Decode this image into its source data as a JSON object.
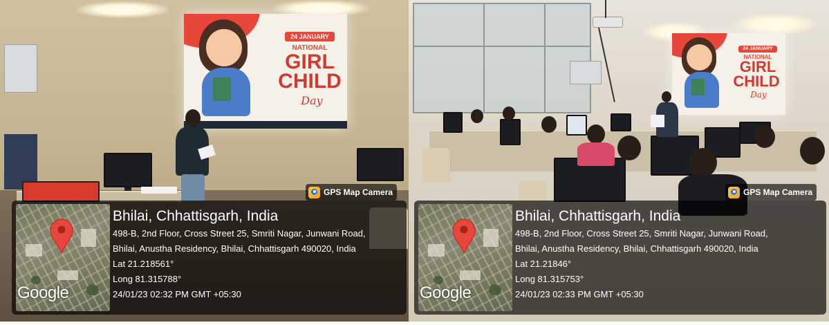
{
  "photos": [
    {
      "projected_slide": {
        "date": "24 JANUARY",
        "line1": "NATIONAL",
        "line2": "GIRL",
        "line3": "CHILD",
        "line4": "Day"
      },
      "badge": {
        "icon": "gps-map-camera-icon",
        "label": "GPS Map Camera"
      },
      "location": {
        "title": "Bhilai, Chhattisgarh, India",
        "address_line1": "498-B, 2nd Floor, Cross Street 25, Smriti Nagar, Junwani Road,",
        "address_line2": "Bhilai, Anustha Residency, Bhilai, Chhattisgarh 490020, India",
        "lat": "Lat 21.218561°",
        "long": "Long 81.315788°",
        "timestamp": "24/01/23 02:32 PM GMT +05:30"
      },
      "map": {
        "provider": "Google",
        "pin_icon": "location-pin-icon",
        "pin_color": "#e8453c"
      }
    },
    {
      "projected_slide": {
        "date": "24 JANUARY",
        "line1": "NATIONAL",
        "line2": "GIRL",
        "line3": "CHILD",
        "line4": "Day"
      },
      "badge": {
        "icon": "gps-map-camera-icon",
        "label": "GPS Map Camera"
      },
      "location": {
        "title": "Bhilai, Chhattisgarh, India",
        "address_line1": "498-B, 2nd Floor, Cross Street 25, Smriti Nagar, Junwani Road,",
        "address_line2": "Bhilai, Anustha Residency, Bhilai, Chhattisgarh 490020, India",
        "lat": "Lat 21.21846°",
        "long": "Long 81.315753°",
        "timestamp": "24/01/23 02:33 PM GMT +05:30"
      },
      "map": {
        "provider": "Google",
        "pin_icon": "location-pin-icon",
        "pin_color": "#e8453c"
      }
    }
  ]
}
